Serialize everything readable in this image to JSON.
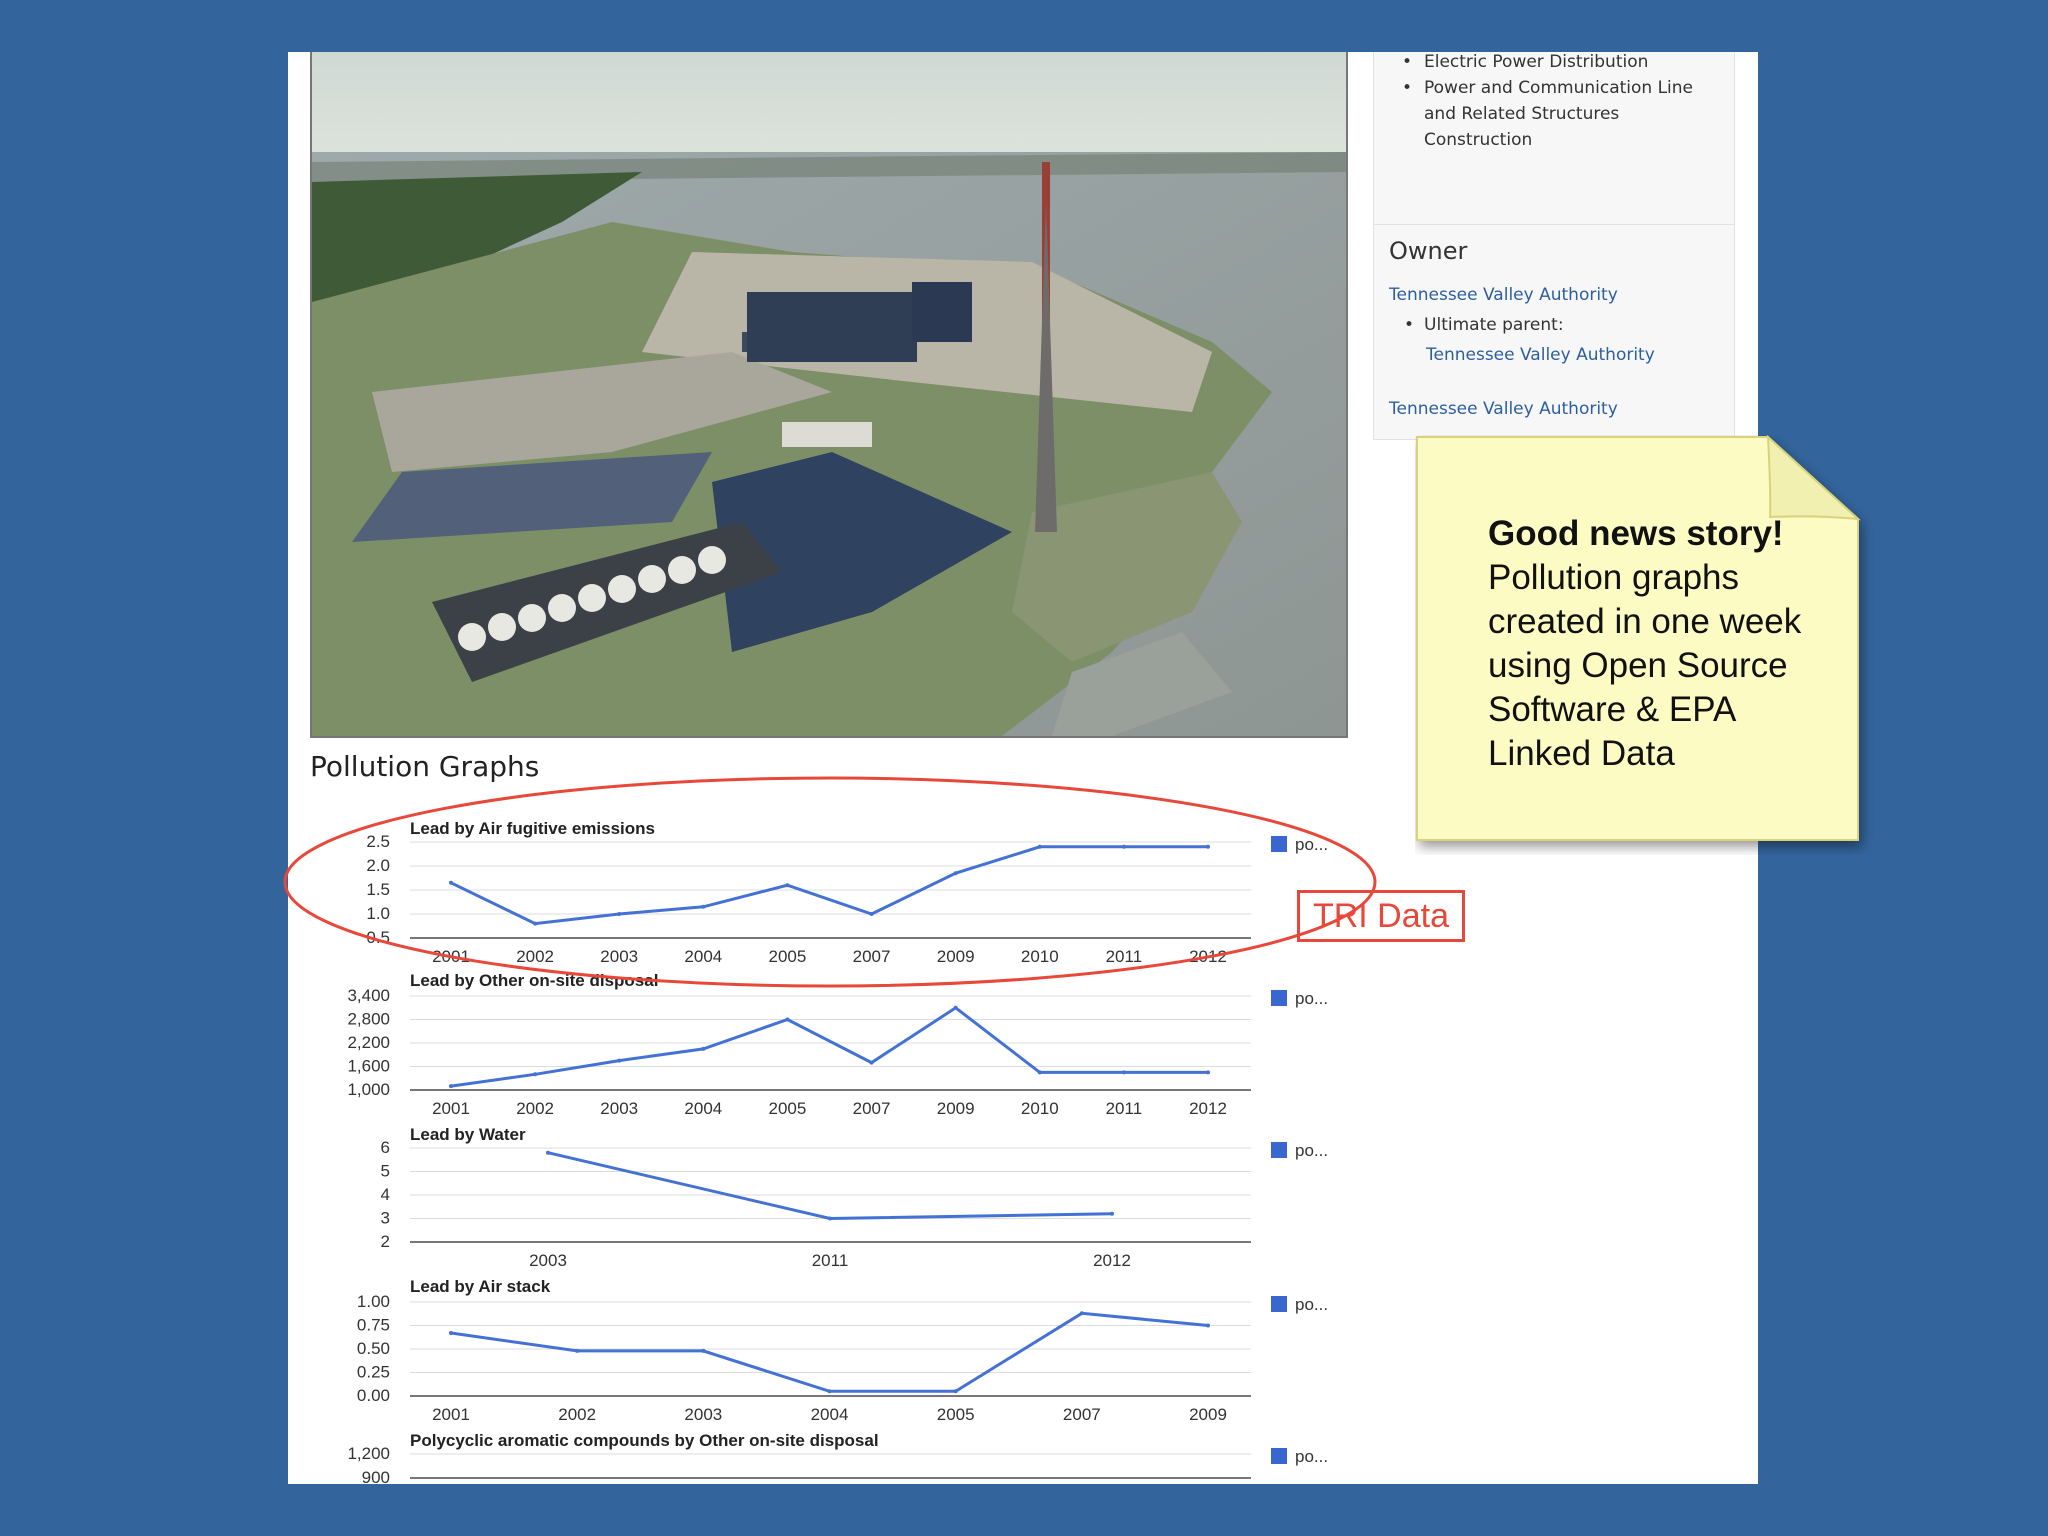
{
  "industries": {
    "items": [
      "Electric Power Distribution",
      "Power and Communication Line and Related Structures Construction"
    ]
  },
  "owner": {
    "heading": "Owner",
    "link1": "Tennessee Valley Authority",
    "parent_label": "Ultimate parent:",
    "parent_link": "Tennessee Valley Authority",
    "link2": "Tennessee Valley Authority"
  },
  "photo": {
    "alt": "Aerial view of power plant beside river with tall smokestack"
  },
  "section_title": "Pollution Graphs",
  "annotation": {
    "headline": "Good news story!",
    "body": "Pollution graphs created in one week using Open Source Software & EPA Linked Data",
    "tri_label": "TRI Data"
  },
  "colors": {
    "line": "#4472d4",
    "legend": "#3a66d0",
    "highlight": "#e8483a",
    "note": "#fbfbc3",
    "background": "#33649b"
  },
  "chart_data": [
    {
      "type": "line",
      "title": "Lead by Air fugitive emissions",
      "categories": [
        "2001",
        "2002",
        "2003",
        "2004",
        "2005",
        "2007",
        "2009",
        "2010",
        "2011",
        "2012"
      ],
      "series": [
        {
          "name": "po...",
          "values": [
            1.65,
            0.8,
            1.0,
            1.15,
            1.6,
            1.0,
            1.85,
            2.4,
            2.4,
            2.4
          ]
        }
      ],
      "yticks": [
        "2.5",
        "2.0",
        "1.5",
        "1.0",
        "0.5"
      ],
      "ylim": [
        0.5,
        2.5
      ],
      "legend": "right"
    },
    {
      "type": "line",
      "title": "Lead by Other on-site disposal",
      "categories": [
        "2001",
        "2002",
        "2003",
        "2004",
        "2005",
        "2007",
        "2009",
        "2010",
        "2011",
        "2012"
      ],
      "series": [
        {
          "name": "po...",
          "values": [
            1100,
            1400,
            1750,
            2050,
            2800,
            1700,
            3100,
            1450,
            1450,
            1450
          ]
        }
      ],
      "yticks": [
        "3,400",
        "2,800",
        "2,200",
        "1,600",
        "1,000"
      ],
      "ylim": [
        1000,
        3400
      ],
      "legend": "right"
    },
    {
      "type": "line",
      "title": "Lead by Water",
      "categories": [
        "2003",
        "2011",
        "2012"
      ],
      "series": [
        {
          "name": "po...",
          "values": [
            5.8,
            3.0,
            3.2
          ]
        }
      ],
      "yticks": [
        "6",
        "5",
        "4",
        "3",
        "2"
      ],
      "ylim": [
        2,
        6
      ],
      "legend": "right"
    },
    {
      "type": "line",
      "title": "Lead by Air stack",
      "categories": [
        "2001",
        "2002",
        "2003",
        "2004",
        "2005",
        "2007",
        "2009"
      ],
      "series": [
        {
          "name": "po...",
          "values": [
            0.67,
            0.48,
            0.48,
            0.05,
            0.05,
            0.88,
            0.75
          ]
        }
      ],
      "yticks": [
        "1.00",
        "0.75",
        "0.50",
        "0.25",
        "0.00"
      ],
      "ylim": [
        0,
        1
      ],
      "legend": "right"
    },
    {
      "type": "line",
      "title": "Polycyclic aromatic compounds by Other on-site disposal",
      "categories": [],
      "series": [
        {
          "name": "po...",
          "values": []
        }
      ],
      "yticks": [
        "1,200",
        "900"
      ],
      "ylim": [
        900,
        1200
      ],
      "legend": "right"
    }
  ]
}
